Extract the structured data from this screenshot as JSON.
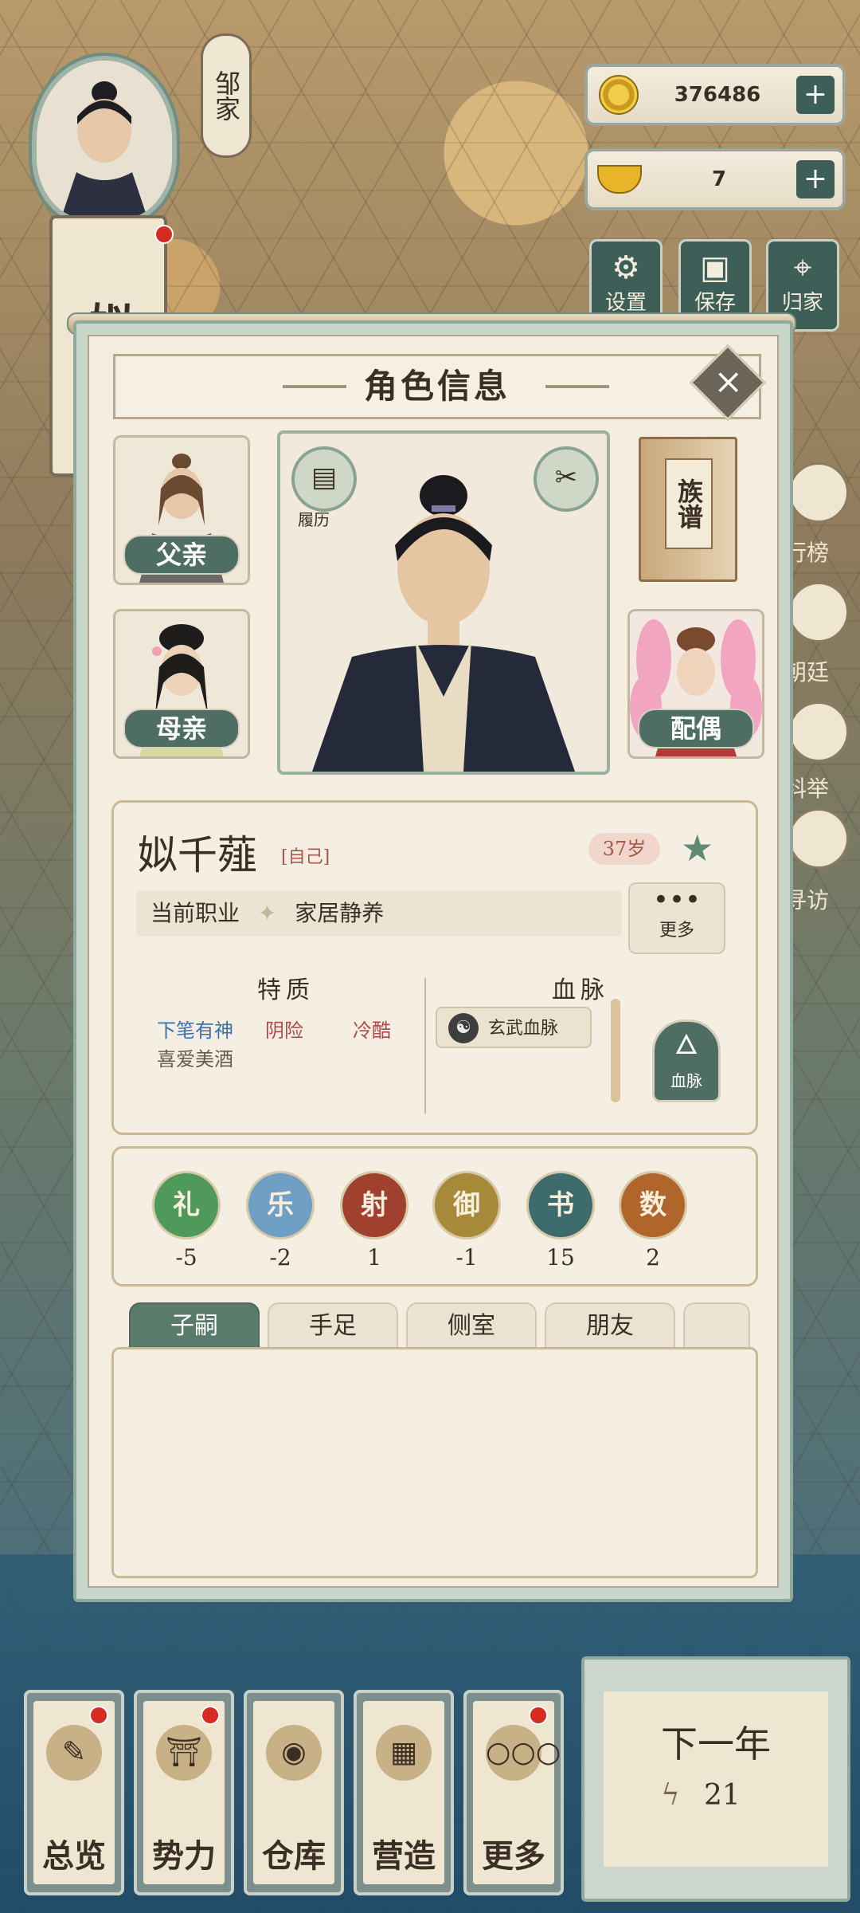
{
  "hud": {
    "family_name": "邹家",
    "player_name_partial": "姒乐",
    "coins": "376486",
    "ingots": "7",
    "buttons": [
      {
        "label": "设置",
        "icon": "gear-icon"
      },
      {
        "label": "保存",
        "icon": "save-icon"
      },
      {
        "label": "归家",
        "icon": "map-pin-icon"
      }
    ],
    "side_items": [
      "行榜",
      "朝廷",
      "科举",
      "寻访"
    ]
  },
  "modal": {
    "title": "角色信息",
    "father_label": "父亲",
    "mother_label": "母亲",
    "spouse_label": "配偶",
    "resume_label": "履历",
    "genealogy_label": "族谱",
    "character": {
      "name": "姒千薤",
      "self_tag": "[自己]",
      "age": "37岁",
      "job_label": "当前职业",
      "job_value": "家居静养",
      "more_label": "更多",
      "traits_header": "特质",
      "bloodline_header": "血脉",
      "traits": [
        {
          "text": "下笔有神",
          "color": "#3a6fb0"
        },
        {
          "text": "阴险",
          "color": "#b04848"
        },
        {
          "text": "冷酷",
          "color": "#b04848"
        },
        {
          "text": "喜爱美酒",
          "color": "#6b5a48"
        }
      ],
      "bloodline_tag": "玄武血脉",
      "bloodline_button": "血脉"
    },
    "stats": [
      {
        "label": "礼",
        "value": "-5",
        "color": "#4f9a5a"
      },
      {
        "label": "乐",
        "value": "-2",
        "color": "#6f9fc4"
      },
      {
        "label": "射",
        "value": "1",
        "color": "#a0412f"
      },
      {
        "label": "御",
        "value": "-1",
        "color": "#a68a3a"
      },
      {
        "label": "书",
        "value": "15",
        "color": "#3d6a6a"
      },
      {
        "label": "数",
        "value": "2",
        "color": "#b0652b"
      }
    ],
    "tabs": [
      "子嗣",
      "手足",
      "侧室",
      "朋友"
    ]
  },
  "bottom_nav": [
    {
      "label": "总览",
      "icon": "scroll-brush-icon"
    },
    {
      "label": "势力",
      "icon": "palace-icon"
    },
    {
      "label": "仓库",
      "icon": "money-bag-icon"
    },
    {
      "label": "营造",
      "icon": "bricks-trowel-icon"
    },
    {
      "label": "更多",
      "icon": "more-icon"
    }
  ],
  "next_year": {
    "label": "下一年",
    "energy": "21"
  },
  "colors": {
    "accent_green": "#4f6e63",
    "paper": "#f4ede0",
    "red_dot": "#d62b22"
  }
}
